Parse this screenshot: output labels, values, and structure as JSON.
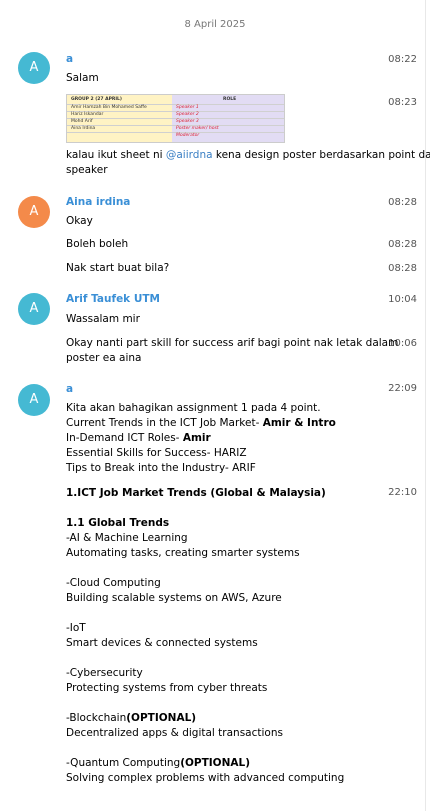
{
  "date_separator": "8 April 2025",
  "messages": [
    {
      "sender": "a",
      "avatar_letter": "A",
      "color": "#45b9d3",
      "time": "08:22",
      "text": "Salam"
    },
    {
      "time": "08:23",
      "caption_before": "kalau ikut sheet ni ",
      "mention": "@aiirdna",
      "caption_after": " kena design poster berdasarkan point dari",
      "caption_line2": "speaker"
    },
    {
      "sender": "Aina irdina",
      "avatar_letter": "A",
      "color": "#f48a4a",
      "time": "08:28",
      "text": "Okay"
    },
    {
      "time": "08:28",
      "text": "Boleh boleh"
    },
    {
      "time": "08:28",
      "text": "Nak start buat bila?"
    },
    {
      "sender": "Arif Taufek UTM",
      "avatar_letter": "A",
      "color": "#45b9d3",
      "time": "10:04",
      "text": "Wassalam mir"
    },
    {
      "time": "10:06",
      "line1": "Okay nanti part skill for success arif bagi point nak letak dalam",
      "line2": "poster ea aina"
    },
    {
      "sender": "a",
      "avatar_letter": "A",
      "color": "#45b9d3",
      "time": "22:09"
    }
  ],
  "sheet": {
    "header_left": "GROUP 2 (27 APRIL)",
    "header_right": "ROLE",
    "names": [
      "Amir Hamzah Bin Mohamed Saffe",
      "Hariz Iskandar",
      "Mohd Arif",
      "Aina Irdina"
    ],
    "roles": [
      "Speaker 1",
      "Speaker 2",
      "Speaker 3",
      "Poster maker/ host",
      "Moderator"
    ]
  },
  "assignment": {
    "l1": "Kita akan bahagikan assignment 1 pada 4 point.",
    "l2a": "Current Trends in the ICT Job Market- ",
    "l2b": "Amir & Intro",
    "l3a": "In-Demand ICT Roles- ",
    "l3b": "Amir",
    "l4": "Essential Skills for Success- HARIZ",
    "l5": "Tips to Break into the Industry- ARIF"
  },
  "trends": {
    "time": "22:10",
    "title": "1.ICT Job Market Trends (Global & Malaysia)",
    "subtitle": "1.1 Global Trends",
    "items": [
      {
        "name": "-AI & Machine Learning",
        "desc": "Automating tasks, creating smarter systems"
      },
      {
        "name": "-Cloud Computing",
        "desc": "Building scalable systems on AWS, Azure"
      },
      {
        "name": "-IoT",
        "desc": "Smart devices & connected systems"
      },
      {
        "name": "-Cybersecurity",
        "desc": "Protecting systems from cyber threats"
      },
      {
        "name": "-Blockchain",
        "opt": "(OPTIONAL)",
        "desc": "Decentralized apps & digital transactions"
      },
      {
        "name": "-Quantum Computing",
        "opt": "(OPTIONAL)",
        "desc": "Solving complex problems with advanced computing"
      }
    ]
  }
}
